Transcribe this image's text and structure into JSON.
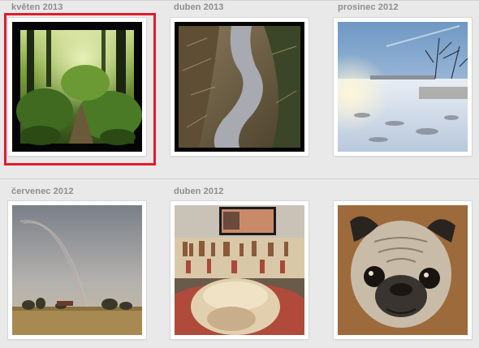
{
  "months": [
    {
      "date_label": "květen 2013",
      "photo_icon": "forest-path-photo",
      "selected": true
    },
    {
      "date_label": "duben 2013",
      "photo_icon": "stream-ditch-photo",
      "selected": false
    },
    {
      "date_label": "prosinec 2012",
      "photo_icon": "snowy-field-photo",
      "selected": false
    },
    {
      "date_label": "červenec 2012",
      "photo_icon": "rainbow-sky-photo",
      "selected": false
    },
    {
      "date_label": "duben 2012",
      "photo_icon": "dog-on-sofa-photo",
      "selected": false
    },
    {
      "date_label": "",
      "photo_icon": "pug-closeup-photo",
      "selected": false
    }
  ],
  "colors": {
    "background": "#e9e9e9",
    "label": "#8e8e8e",
    "selection": "#e11d2c",
    "card": "#ffffff"
  }
}
